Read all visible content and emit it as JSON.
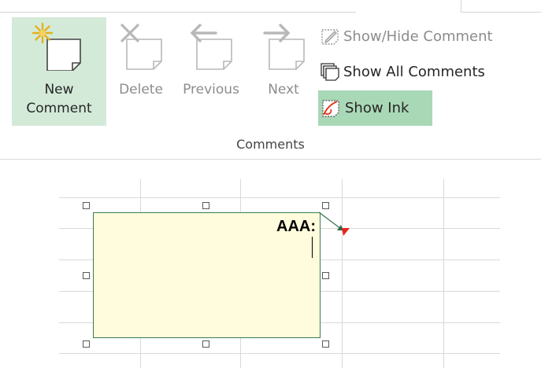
{
  "ribbon": {
    "group_label": "Comments",
    "buttons": {
      "new_comment": {
        "line1": "New",
        "line2": "Comment"
      },
      "delete": "Delete",
      "previous": "Previous",
      "next": "Next"
    },
    "small_buttons": {
      "show_hide": "Show/Hide Comment",
      "show_all": "Show All Comments",
      "show_ink": "Show Ink"
    }
  },
  "sheet": {
    "comment": {
      "text": "AAA:"
    }
  },
  "colors": {
    "selected_button_bg": "#d3ead8",
    "show_ink_bg": "#a9d8b6",
    "comment_bg": "#fefcdc",
    "comment_border": "#3d7a52",
    "comment_indicator": "#ff0000"
  }
}
